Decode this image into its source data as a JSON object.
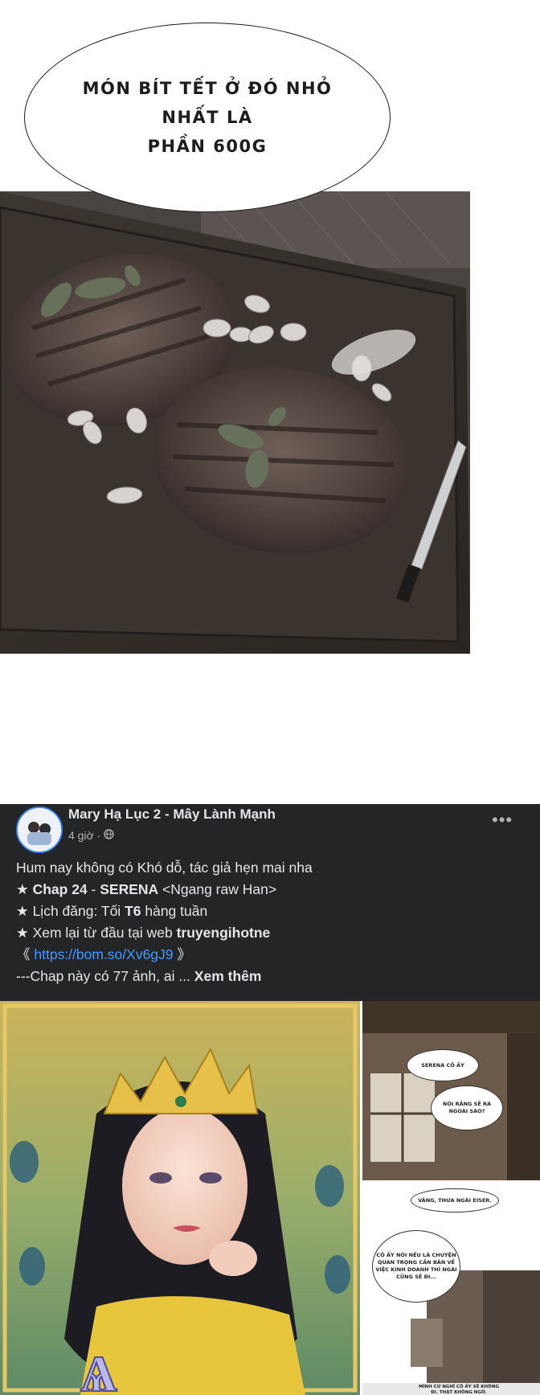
{
  "comic": {
    "speech_line1": "MÓN BÍT TẾT Ở ĐÓ NHỎ NHẤT LÀ",
    "speech_line2": "PHẦN 600G"
  },
  "post": {
    "author": "Mary Hạ Lục 2 - Mây Lành Mạnh",
    "time": "4 giờ",
    "time_separator": "·",
    "line1": "Hum nay không có Khó dỗ, tác giả hẹn mai nha",
    "star": "★",
    "chap_label": "Chap 24",
    "chap_sep": " - ",
    "chap_title": "SERENA",
    "chap_rest": " <Ngang raw Han>",
    "schedule_prefix": "Lịch đăng: Tối ",
    "schedule_day": "T6",
    "schedule_suffix": " hàng tuần",
    "web_prefix": "Xem lại từ đầu tại web ",
    "web_name": "truyengihotne",
    "link_open": "《 ",
    "link_url": "https://bom.so/Xv6gJ9",
    "link_close": " 》",
    "truncated": "---Chap này có 77 ảnh, ai ... ",
    "see_more": "Xem thêm",
    "more_glyph": "•••"
  },
  "thumbs": {
    "bubble1": "SERENA CÔ ẤY",
    "bubble2": "NÓI RẰNG SẼ RA NGOÀI SAO?",
    "bubble3": "VÂNG, THƯA NGÀI EISER.",
    "bubble4": "CÔ ẤY NÓI NẾU LÀ CHUYỆN QUAN TRỌNG CẦN BÀN VỀ VIỆC KINH DOANH THÌ NGÀI CŨNG SẼ ĐI...",
    "bottom_text": "MÌNH CỨ NGHĨ CÔ ẤY SẼ KHÔNG ĐI. THẬT KHÔNG NGỜ."
  },
  "colors": {
    "post_bg": "#242526",
    "post_text": "#e4e6eb",
    "meta_text": "#b0b3b8",
    "link": "#4599ff"
  }
}
